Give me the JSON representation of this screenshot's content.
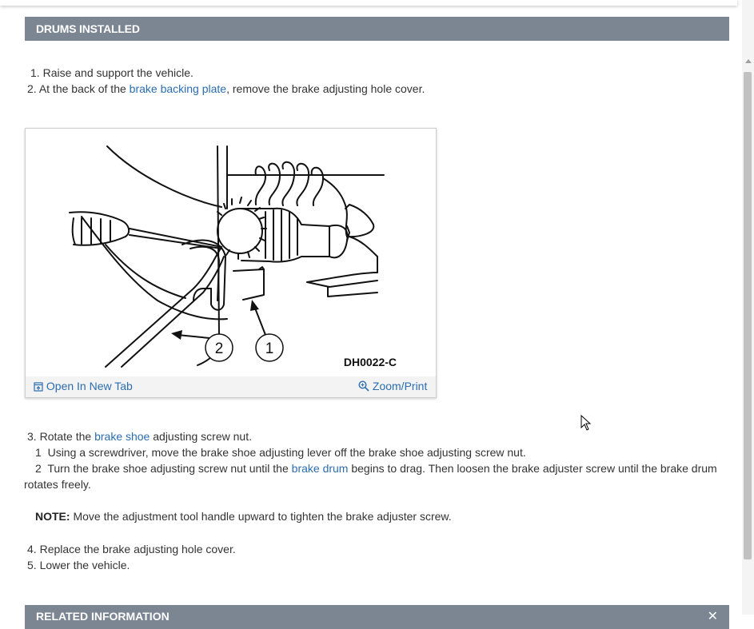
{
  "section_title": "DRUMS INSTALLED",
  "steps_a": [
    {
      "num": "1.",
      "text": "Raise and support the vehicle."
    },
    {
      "num": "2.",
      "pre": "At the back of the ",
      "link": "brake backing plate",
      "post": ", remove the brake adjusting hole cover."
    }
  ],
  "figure": {
    "code": "DH0022-C",
    "callouts": [
      "1",
      "2"
    ],
    "open_label": "Open In New Tab",
    "zoom_label": "Zoom/Print"
  },
  "step3": {
    "num": "3.",
    "pre": "Rotate the ",
    "link": "brake shoe",
    "post": " adjusting screw nut."
  },
  "substeps": [
    {
      "num": "1",
      "text": "Using a screwdriver, move the brake shoe adjusting lever off the brake shoe adjusting screw nut."
    },
    {
      "num": "2",
      "pre": "Turn the brake shoe adjusting screw nut until the ",
      "link": "brake drum",
      "post": " begins to drag. Then loosen the brake adjuster screw until the brake drum",
      "cont": "rotates freely."
    }
  ],
  "note": {
    "label": "NOTE:",
    "text": " Move the adjustment tool handle upward to tighten the brake adjuster screw."
  },
  "steps_b": [
    {
      "num": "4.",
      "text": "Replace the brake adjusting hole cover."
    },
    {
      "num": "5.",
      "text": "Lower the vehicle."
    }
  ],
  "related_title": "RELATED INFORMATION",
  "related_close": "✕"
}
